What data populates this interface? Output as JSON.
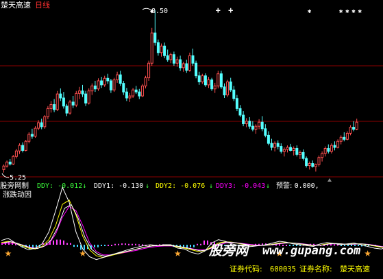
{
  "header": {
    "stock_name": "楚天高速",
    "period": "日线"
  },
  "price_panel": {
    "high_label": "8.50",
    "low_label": "5.25"
  },
  "indicator_panel": {
    "name": "股旁网制",
    "sub_name": "涨跌动因",
    "ddy_label": "DDY: ",
    "ddy_value": "-0.012",
    "ddy_arrow": "↓",
    "ddy1_label": "DDY1: ",
    "ddy1_value": "-0.130",
    "ddy1_arrow": "↓",
    "ddy2_label": "DDY2: ",
    "ddy2_value": "-0.076",
    "ddy2_arrow": "↓",
    "ddy3_label": "DDY3: ",
    "ddy3_value": "-0.043",
    "ddy3_arrow": "↓",
    "alert_label": "预警: ",
    "alert_value": "0.000,"
  },
  "footer": {
    "code_label": "证券代码: ",
    "code_value": "600035",
    "name_label": "证券名称: ",
    "name_value": "楚天高速"
  },
  "watermark": {
    "text": "股旁网",
    "url": "www.gupang.com"
  },
  "colors": {
    "up_candle": "#ff5050",
    "down_candle": "#54ffff",
    "grid_red": "#8b0000",
    "ddy": "#3cff3c",
    "ddy1": "#ffffff",
    "ddy2": "#ffff00",
    "ddy3": "#ff00ff",
    "star": "#ffaa33",
    "footer_text": "#ffff00"
  },
  "chart_data": {
    "type": "candlestick",
    "price_range": [
      5.25,
      8.5
    ],
    "candles": [
      [
        5.34,
        5.44,
        5.28,
        5.41
      ],
      [
        5.41,
        5.52,
        5.38,
        5.49
      ],
      [
        5.49,
        5.55,
        5.42,
        5.45
      ],
      [
        5.45,
        5.63,
        5.43,
        5.6
      ],
      [
        5.6,
        5.75,
        5.56,
        5.71
      ],
      [
        5.71,
        5.86,
        5.65,
        5.82
      ],
      [
        5.82,
        5.88,
        5.68,
        5.72
      ],
      [
        5.72,
        5.93,
        5.7,
        5.9
      ],
      [
        5.9,
        6.08,
        5.86,
        6.04
      ],
      [
        6.04,
        6.15,
        5.95,
        6.0
      ],
      [
        6.0,
        6.2,
        5.97,
        6.16
      ],
      [
        6.16,
        6.32,
        6.12,
        6.27
      ],
      [
        6.27,
        6.35,
        6.14,
        6.19
      ],
      [
        6.19,
        6.42,
        6.15,
        6.39
      ],
      [
        6.39,
        6.6,
        6.34,
        6.55
      ],
      [
        6.55,
        6.7,
        6.47,
        6.63
      ],
      [
        6.63,
        6.74,
        6.48,
        6.53
      ],
      [
        6.53,
        6.9,
        6.5,
        6.84
      ],
      [
        6.84,
        6.95,
        6.7,
        6.76
      ],
      [
        6.76,
        6.88,
        6.55,
        6.6
      ],
      [
        6.6,
        6.64,
        6.4,
        6.46
      ],
      [
        6.46,
        6.72,
        6.43,
        6.68
      ],
      [
        6.68,
        6.8,
        6.56,
        6.62
      ],
      [
        6.62,
        6.9,
        6.58,
        6.85
      ],
      [
        6.85,
        6.98,
        6.74,
        6.9
      ],
      [
        6.9,
        7.02,
        6.78,
        6.84
      ],
      [
        6.84,
        6.9,
        6.6,
        6.66
      ],
      [
        6.66,
        6.95,
        6.63,
        6.9
      ],
      [
        6.9,
        7.05,
        6.82,
        7.0
      ],
      [
        7.0,
        7.1,
        6.88,
        6.94
      ],
      [
        6.94,
        7.15,
        6.9,
        7.1
      ],
      [
        7.1,
        7.18,
        6.96,
        7.02
      ],
      [
        7.02,
        7.2,
        6.98,
        7.15
      ],
      [
        7.15,
        7.24,
        7.04,
        7.1
      ],
      [
        7.1,
        7.14,
        6.86,
        6.92
      ],
      [
        6.92,
        7.16,
        6.88,
        7.12
      ],
      [
        7.12,
        7.28,
        7.06,
        7.22
      ],
      [
        7.22,
        7.3,
        7.0,
        7.05
      ],
      [
        7.05,
        7.1,
        6.82,
        6.88
      ],
      [
        6.88,
        6.96,
        6.7,
        6.76
      ],
      [
        6.76,
        6.86,
        6.68,
        6.8
      ],
      [
        6.8,
        6.96,
        6.76,
        6.92
      ],
      [
        6.92,
        7.0,
        6.84,
        6.88
      ],
      [
        6.88,
        6.94,
        6.74,
        6.8
      ],
      [
        6.8,
        7.04,
        6.78,
        7.0
      ],
      [
        7.0,
        7.2,
        6.95,
        7.16
      ],
      [
        7.16,
        7.5,
        7.1,
        7.45
      ],
      [
        7.45,
        8.15,
        7.4,
        8.05
      ],
      [
        8.05,
        8.5,
        7.8,
        7.86
      ],
      [
        7.86,
        7.92,
        7.6,
        7.66
      ],
      [
        7.66,
        7.84,
        7.58,
        7.79
      ],
      [
        7.79,
        7.86,
        7.55,
        7.6
      ],
      [
        7.6,
        7.72,
        7.48,
        7.52
      ],
      [
        7.52,
        7.66,
        7.45,
        7.62
      ],
      [
        7.62,
        7.68,
        7.4,
        7.45
      ],
      [
        7.45,
        7.58,
        7.38,
        7.52
      ],
      [
        7.52,
        7.6,
        7.3,
        7.36
      ],
      [
        7.36,
        7.48,
        7.28,
        7.44
      ],
      [
        7.44,
        7.52,
        7.26,
        7.31
      ],
      [
        7.31,
        7.66,
        7.28,
        7.6
      ],
      [
        7.6,
        7.74,
        7.4,
        7.45
      ],
      [
        7.45,
        7.5,
        7.15,
        7.2
      ],
      [
        7.2,
        7.28,
        7.02,
        7.08
      ],
      [
        7.08,
        7.24,
        7.04,
        7.2
      ],
      [
        7.2,
        7.25,
        6.98,
        7.02
      ],
      [
        7.02,
        7.18,
        6.96,
        7.12
      ],
      [
        7.12,
        7.16,
        6.9,
        6.94
      ],
      [
        6.94,
        7.06,
        6.86,
        7.0
      ],
      [
        7.0,
        7.3,
        6.95,
        7.24
      ],
      [
        7.24,
        7.3,
        6.94,
        6.98
      ],
      [
        6.98,
        7.05,
        6.76,
        6.82
      ],
      [
        6.82,
        7.12,
        6.78,
        7.08
      ],
      [
        7.08,
        7.16,
        6.88,
        6.92
      ],
      [
        6.92,
        7.0,
        6.7,
        6.75
      ],
      [
        6.75,
        6.82,
        6.5,
        6.55
      ],
      [
        6.55,
        6.62,
        6.38,
        6.42
      ],
      [
        6.42,
        6.5,
        6.2,
        6.25
      ],
      [
        6.25,
        6.36,
        6.18,
        6.3
      ],
      [
        6.3,
        6.38,
        6.15,
        6.2
      ],
      [
        6.2,
        6.3,
        6.1,
        6.14
      ],
      [
        6.14,
        6.24,
        6.05,
        6.2
      ],
      [
        6.2,
        6.34,
        6.14,
        6.28
      ],
      [
        6.28,
        6.4,
        6.1,
        6.15
      ],
      [
        6.15,
        6.24,
        5.98,
        6.02
      ],
      [
        6.02,
        6.1,
        5.82,
        5.86
      ],
      [
        5.86,
        5.95,
        5.72,
        5.78
      ],
      [
        5.78,
        5.9,
        5.7,
        5.86
      ],
      [
        5.86,
        5.92,
        5.74,
        5.8
      ],
      [
        5.8,
        5.86,
        5.66,
        5.7
      ],
      [
        5.7,
        5.78,
        5.6,
        5.74
      ],
      [
        5.74,
        5.82,
        5.68,
        5.78
      ],
      [
        5.78,
        5.85,
        5.7,
        5.72
      ],
      [
        5.72,
        5.8,
        5.62,
        5.76
      ],
      [
        5.76,
        5.82,
        5.6,
        5.64
      ],
      [
        5.64,
        5.72,
        5.55,
        5.68
      ],
      [
        5.68,
        5.74,
        5.52,
        5.56
      ],
      [
        5.56,
        5.6,
        5.38,
        5.42
      ],
      [
        5.42,
        5.5,
        5.34,
        5.46
      ],
      [
        5.46,
        5.52,
        5.38,
        5.4
      ],
      [
        5.4,
        5.46,
        5.3,
        5.44
      ],
      [
        5.44,
        5.62,
        5.4,
        5.58
      ],
      [
        5.58,
        5.7,
        5.5,
        5.66
      ],
      [
        5.66,
        5.8,
        5.6,
        5.76
      ],
      [
        5.76,
        5.84,
        5.66,
        5.7
      ],
      [
        5.7,
        5.86,
        5.66,
        5.82
      ],
      [
        5.82,
        5.9,
        5.72,
        5.78
      ],
      [
        5.78,
        5.94,
        5.76,
        5.9
      ],
      [
        5.9,
        6.02,
        5.84,
        5.98
      ],
      [
        5.98,
        6.08,
        5.9,
        5.94
      ],
      [
        5.94,
        6.1,
        5.92,
        6.06
      ],
      [
        6.06,
        6.22,
        6.02,
        6.18
      ],
      [
        6.18,
        6.3,
        6.1,
        6.14
      ],
      [
        6.14,
        6.35,
        6.12,
        6.28
      ]
    ],
    "line_series": {
      "ddy1": [
        0.1,
        0.15,
        0.05,
        -0.05,
        -0.12,
        -0.08,
        0.02,
        0.3,
        0.8,
        1.35,
        1.0,
        0.3,
        -0.1,
        -0.28,
        -0.35,
        -0.3,
        -0.25,
        -0.2,
        -0.15,
        -0.1,
        -0.06,
        -0.02,
        0.0,
        -0.02,
        0.0,
        0.0,
        -0.08,
        -0.1,
        -0.18,
        -0.22,
        -0.15,
        0.04,
        0.12,
        0.08,
        0.02,
        -0.02,
        -0.05,
        -0.04,
        -0.02,
        0.0,
        0.04,
        0.08,
        0.06,
        0.02,
        0.0,
        -0.02,
        -0.04,
        0.02,
        0.05,
        0.03,
        0.0,
        0.02,
        0.04,
        0.0,
        -0.04,
        -0.08,
        -0.1,
        -0.06
      ],
      "ddy2": [
        0.05,
        0.08,
        0.04,
        -0.02,
        -0.08,
        -0.1,
        -0.04,
        0.12,
        0.45,
        0.95,
        1.05,
        0.7,
        0.2,
        -0.12,
        -0.26,
        -0.3,
        -0.26,
        -0.22,
        -0.18,
        -0.14,
        -0.1,
        -0.06,
        -0.03,
        -0.02,
        -0.02,
        -0.02,
        -0.05,
        -0.08,
        -0.12,
        -0.16,
        -0.14,
        -0.05,
        0.04,
        0.07,
        0.06,
        0.03,
        0.0,
        -0.02,
        -0.02,
        -0.01,
        0.01,
        0.04,
        0.05,
        0.04,
        0.02,
        0.0,
        -0.02,
        -0.01,
        0.02,
        0.03,
        0.02,
        0.01,
        0.02,
        0.02,
        0.0,
        -0.03,
        -0.06,
        -0.07
      ],
      "ddy3": [
        0.02,
        0.04,
        0.03,
        0.0,
        -0.05,
        -0.08,
        -0.06,
        0.02,
        0.25,
        0.65,
        0.9,
        0.8,
        0.45,
        0.05,
        -0.16,
        -0.24,
        -0.24,
        -0.22,
        -0.19,
        -0.16,
        -0.13,
        -0.09,
        -0.06,
        -0.04,
        -0.03,
        -0.03,
        -0.04,
        -0.06,
        -0.09,
        -0.12,
        -0.12,
        -0.08,
        -0.01,
        0.04,
        0.05,
        0.04,
        0.02,
        0.0,
        -0.01,
        -0.01,
        0.0,
        0.02,
        0.04,
        0.04,
        0.03,
        0.01,
        -0.01,
        -0.01,
        0.01,
        0.02,
        0.02,
        0.01,
        0.01,
        0.02,
        0.01,
        -0.01,
        -0.04,
        -0.05
      ],
      "ddy_bars": [
        0.05,
        0.08,
        0.02,
        -0.06,
        -0.1,
        -0.06,
        0.04,
        0.1,
        0.12,
        0.1,
        0.04,
        -0.05,
        -0.12,
        -0.1,
        -0.06,
        -0.02,
        0.0,
        0.02,
        0.03,
        0.02,
        0.02,
        0.01,
        0.0,
        0.0,
        0.01,
        -0.02,
        -0.05,
        -0.08,
        -0.1,
        -0.06,
        0.02,
        0.1,
        0.06,
        0.02,
        -0.02,
        -0.03,
        -0.02,
        0.0,
        0.01,
        0.02,
        0.03,
        0.02,
        0.01,
        0.0,
        -0.01,
        -0.02,
        0.01,
        0.02,
        0.01,
        0.0,
        0.01,
        0.01,
        -0.01,
        -0.02,
        -0.03,
        -0.04,
        -0.03,
        -0.02
      ]
    },
    "star_positions": [
      1,
      12,
      26,
      41,
      54
    ],
    "top_markers": [
      {
        "index": 47,
        "kind": "diamond"
      },
      {
        "index": 68,
        "kind": "plus"
      },
      {
        "index": 72,
        "kind": "plus"
      },
      {
        "index": 97,
        "kind": "asterisk"
      },
      {
        "index": 107,
        "kind": "asterisk"
      },
      {
        "index": 109,
        "kind": "asterisk"
      },
      {
        "index": 111,
        "kind": "asterisk"
      },
      {
        "index": 113,
        "kind": "asterisk"
      }
    ],
    "high_index": 48,
    "low_index": 0
  }
}
